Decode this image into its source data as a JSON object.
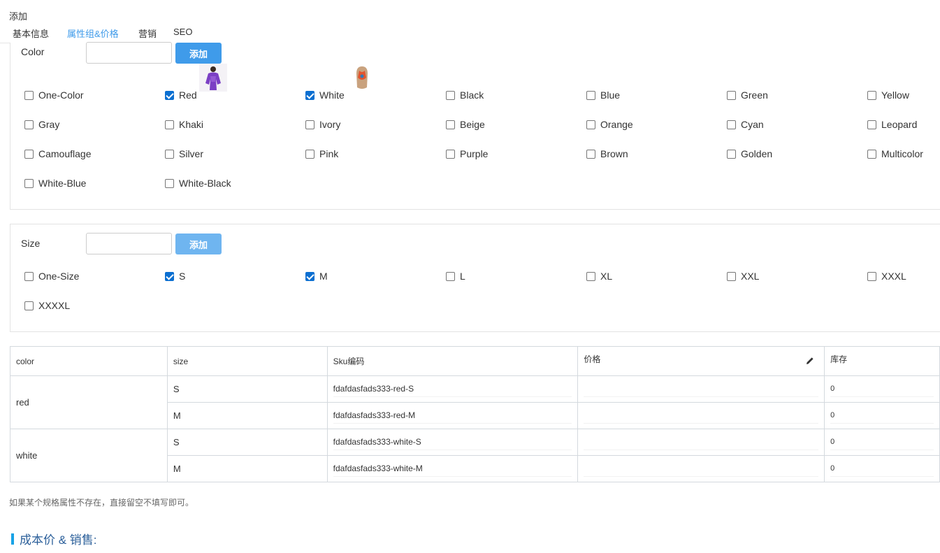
{
  "page": {
    "title": "添加"
  },
  "tabs": [
    {
      "label": "基本信息",
      "active": false
    },
    {
      "label": "属性组&价格",
      "active": true
    },
    {
      "label": "营销",
      "active": false
    },
    {
      "label": "SEO",
      "active": false
    }
  ],
  "color_group": {
    "label": "Color",
    "input_value": "",
    "add_label": "添加",
    "options": [
      {
        "label": "One-Color",
        "checked": false
      },
      {
        "label": "Red",
        "checked": true,
        "image": "model-purple-dress-thumbnail"
      },
      {
        "label": "White",
        "checked": true,
        "image": "necklace-thumbnail"
      },
      {
        "label": "Black",
        "checked": false
      },
      {
        "label": "Blue",
        "checked": false
      },
      {
        "label": "Green",
        "checked": false
      },
      {
        "label": "Yellow",
        "checked": false
      },
      {
        "label": "Gray",
        "checked": false
      },
      {
        "label": "Khaki",
        "checked": false
      },
      {
        "label": "Ivory",
        "checked": false
      },
      {
        "label": "Beige",
        "checked": false
      },
      {
        "label": "Orange",
        "checked": false
      },
      {
        "label": "Cyan",
        "checked": false
      },
      {
        "label": "Leopard",
        "checked": false
      },
      {
        "label": "Camouflage",
        "checked": false
      },
      {
        "label": "Silver",
        "checked": false
      },
      {
        "label": "Pink",
        "checked": false
      },
      {
        "label": "Purple",
        "checked": false
      },
      {
        "label": "Brown",
        "checked": false
      },
      {
        "label": "Golden",
        "checked": false
      },
      {
        "label": "Multicolor",
        "checked": false
      },
      {
        "label": "White-Blue",
        "checked": false
      },
      {
        "label": "White-Black",
        "checked": false
      }
    ]
  },
  "size_group": {
    "label": "Size",
    "input_value": "",
    "add_label": "添加",
    "options": [
      {
        "label": "One-Size",
        "checked": false
      },
      {
        "label": "S",
        "checked": true
      },
      {
        "label": "M",
        "checked": true
      },
      {
        "label": "L",
        "checked": false
      },
      {
        "label": "XL",
        "checked": false
      },
      {
        "label": "XXL",
        "checked": false
      },
      {
        "label": "XXXL",
        "checked": false
      },
      {
        "label": "XXXXL",
        "checked": false
      }
    ]
  },
  "sku_table": {
    "headers": {
      "color": "color",
      "size": "size",
      "sku": "Sku编码",
      "price": "价格",
      "stock": "库存"
    },
    "groups": [
      {
        "color": "red",
        "rows": [
          {
            "size": "S",
            "sku": "fdafdasfads333-red-S",
            "price": "",
            "stock": "0"
          },
          {
            "size": "M",
            "sku": "fdafdasfads333-red-M",
            "price": "",
            "stock": "0"
          }
        ]
      },
      {
        "color": "white",
        "rows": [
          {
            "size": "S",
            "sku": "fdafdasfads333-white-S",
            "price": "",
            "stock": "0"
          },
          {
            "size": "M",
            "sku": "fdafdasfads333-white-M",
            "price": "",
            "stock": "0"
          }
        ]
      }
    ]
  },
  "hint": "如果某个规格属性不存在，直接留空不填写即可。",
  "section": {
    "title": "成本价 & 销售:"
  },
  "colors": {
    "accent": "#3f9bea",
    "accent_light": "#6fb5f0",
    "checkbox_checked": "#0b6fd1",
    "section_bar": "#17a2e6",
    "section_text": "#2b5f9a"
  }
}
